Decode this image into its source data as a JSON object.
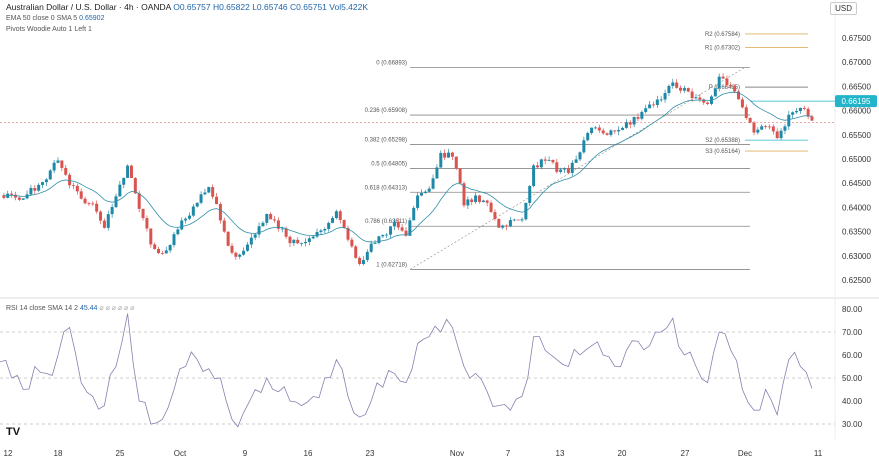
{
  "header": {
    "symbol": "Australian Dollar / U.S. Dollar · 4h · OANDA",
    "open": "O0.65757",
    "high": "H0.65822",
    "low": "L0.65746",
    "close": "C0.65751",
    "volume": "Vol5.422K",
    "currency": "USD"
  },
  "indicators": {
    "ema": "EMA 50 close 0 SMA 5",
    "ema_value": "0.65902",
    "pivots": "Pivots Woodie Auto 1 Left 1",
    "rsi": "RSI 14 close SMA 14 2",
    "rsi_value": "45.44"
  },
  "price_axis": [
    "0.67500",
    "0.67000",
    "0.66500",
    "0.66000",
    "0.65500",
    "0.65000",
    "0.64500",
    "0.64000",
    "0.63500",
    "0.63000",
    "0.62500"
  ],
  "current_price": "0.66195",
  "rsi_axis": [
    "80.00",
    "70.00",
    "60.00",
    "50.00",
    "40.00",
    "30.00"
  ],
  "time_axis": [
    "12",
    "18",
    "25",
    "Oct",
    "9",
    "16",
    "23",
    "Nov",
    "7",
    "13",
    "20",
    "27",
    "Dec",
    "11"
  ],
  "fib_levels": [
    {
      "label": "0 (0.66893)",
      "price": 0.66893
    },
    {
      "label": "0.236 (0.65908)",
      "price": 0.65908
    },
    {
      "label": "0.382 (0.65298)",
      "price": 0.65298
    },
    {
      "label": "0.5 (0.64805)",
      "price": 0.64805
    },
    {
      "label": "0.618 (0.64313)",
      "price": 0.64313
    },
    {
      "label": "0.786 (0.63611)",
      "price": 0.63611
    },
    {
      "label": "1 (0.62718)",
      "price": 0.62718
    }
  ],
  "pivot_levels": [
    {
      "label": "R2 (0.67584)",
      "price": 0.67584,
      "color": "#e0b060"
    },
    {
      "label": "R1 (0.67302)",
      "price": 0.67302,
      "color": "#e0b060"
    },
    {
      "label": "P (0.66485)",
      "price": 0.66485,
      "color": "#888888"
    },
    {
      "label": "S2 (0.65388)",
      "price": 0.65388,
      "color": "#4cc3d0"
    },
    {
      "label": "S3 (0.65164)",
      "price": 0.65164,
      "color": "#e0b060"
    }
  ],
  "colors": {
    "up": "#1e88a8",
    "down": "#d9534f",
    "ema": "#2f8fa8",
    "rsi": "#8a7fb0",
    "price_tag": "#22b5c9"
  },
  "chart_data": {
    "type": "candlestick",
    "closes": [
      0.6425,
      0.642,
      0.642,
      0.644,
      0.646,
      0.65,
      0.645,
      0.642,
      0.64,
      0.636,
      0.642,
      0.649,
      0.64,
      0.633,
      0.63,
      0.634,
      0.638,
      0.641,
      0.644,
      0.638,
      0.63,
      0.631,
      0.635,
      0.638,
      0.636,
      0.633,
      0.633,
      0.634,
      0.636,
      0.639,
      0.634,
      0.628,
      0.632,
      0.634,
      0.637,
      0.634,
      0.643,
      0.644,
      0.651,
      0.651,
      0.641,
      0.642,
      0.641,
      0.636,
      0.637,
      0.637,
      0.648,
      0.65,
      0.648,
      0.647,
      0.652,
      0.656,
      0.656,
      0.655,
      0.657,
      0.659,
      0.661,
      0.663,
      0.666,
      0.664,
      0.662,
      0.661,
      0.667,
      0.665,
      0.66,
      0.656,
      0.657,
      0.654,
      0.659,
      0.661,
      0.6575
    ],
    "rsi": [
      57,
      50,
      45,
      55,
      52,
      60,
      72,
      48,
      42,
      38,
      55,
      78,
      40,
      30,
      32,
      45,
      55,
      58,
      54,
      50,
      32,
      35,
      45,
      50,
      44,
      40,
      38,
      42,
      50,
      58,
      42,
      33,
      40,
      46,
      52,
      48,
      65,
      68,
      70,
      72,
      55,
      52,
      44,
      38,
      36,
      42,
      68,
      62,
      58,
      55,
      60,
      64,
      60,
      55,
      62,
      66,
      64,
      70,
      76,
      60,
      55,
      48,
      70,
      62,
      45,
      36,
      45,
      34,
      58,
      55,
      45.44
    ],
    "ylim": [
      0.625,
      0.6775
    ]
  }
}
